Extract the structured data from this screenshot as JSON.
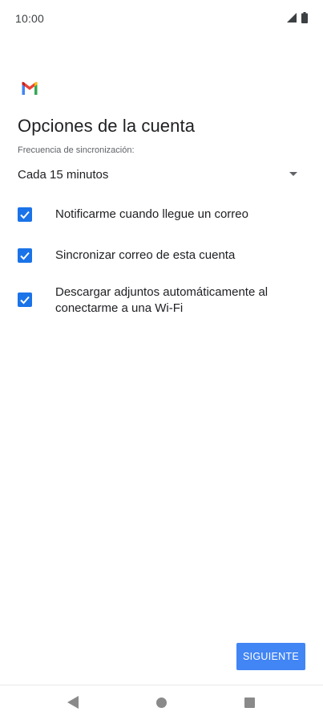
{
  "status_bar": {
    "time": "10:00",
    "icons": [
      "signal-icon",
      "battery-icon"
    ]
  },
  "header": {
    "logo": "gmail-logo-icon",
    "title": "Opciones de la cuenta"
  },
  "sync": {
    "label": "Frecuencia de sincronización:",
    "selected_value": "Cada 15 minutos",
    "dropdown_icon": "dropdown-arrow-icon"
  },
  "options": [
    {
      "label": "Notificarme cuando llegue un correo",
      "checked": true
    },
    {
      "label": "Sincronizar correo de esta cuenta",
      "checked": true
    },
    {
      "label": "Descargar adjuntos automáticamente al conectarme a una Wi-Fi",
      "checked": true
    }
  ],
  "footer": {
    "next_label": "SIGUIENTE"
  },
  "nav_bar": {
    "icons": [
      "back-icon",
      "home-icon",
      "recents-icon"
    ]
  },
  "colors": {
    "accent": "#1a73e8",
    "button": "#4285f4",
    "text_primary": "#202124",
    "text_secondary": "#5f6368",
    "nav_icons": "#8a8a8a"
  }
}
